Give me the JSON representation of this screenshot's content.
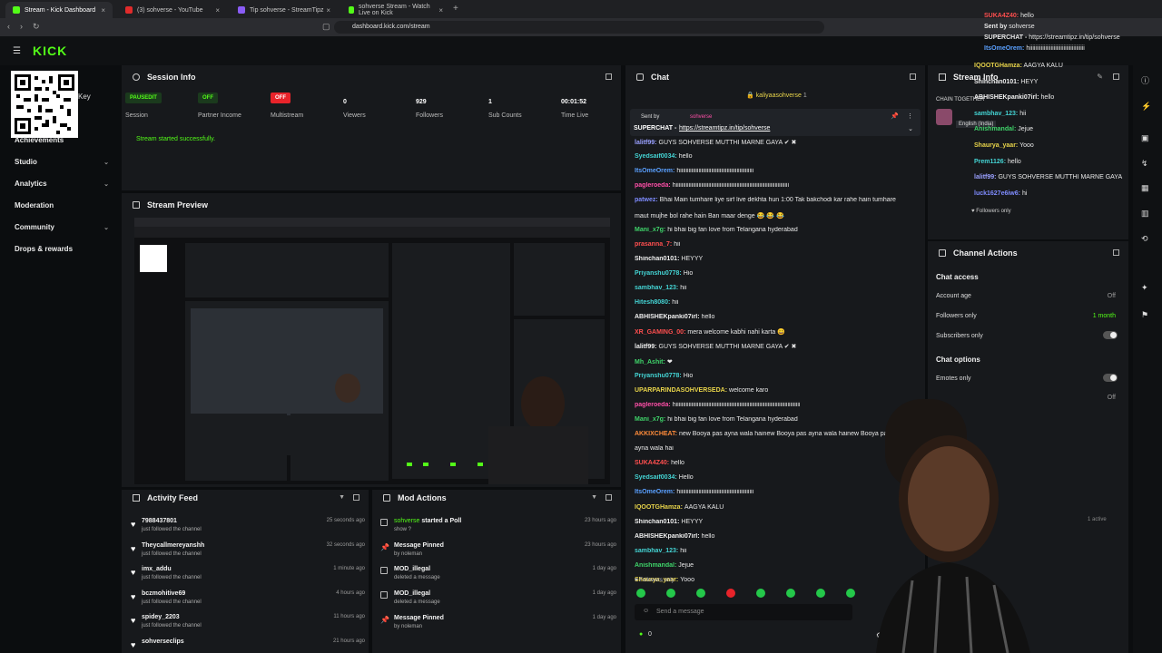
{
  "browser": {
    "tabs": [
      {
        "title": "Stream - Kick Dashboard",
        "active": true
      },
      {
        "title": "(3) sohverse - YouTube",
        "active": false
      },
      {
        "title": "Tip sohverse - StreamTipz",
        "active": false
      },
      {
        "title": "sohverse Stream - Watch Live on Kick",
        "active": false
      }
    ],
    "url": "dashboard.kick.com/stream"
  },
  "sidebar": {
    "logo": "KICK",
    "key_label": "Key",
    "items": [
      {
        "label": "Achievements",
        "has_chevron": false
      },
      {
        "label": "Studio",
        "has_chevron": true
      },
      {
        "label": "Analytics",
        "has_chevron": true
      },
      {
        "label": "Moderation",
        "has_chevron": false
      },
      {
        "label": "Community",
        "has_chevron": true
      },
      {
        "label": "Drops & rewards",
        "has_chevron": false
      }
    ]
  },
  "session": {
    "title": "Session Info",
    "stats": [
      {
        "value": "PAUSEDIT",
        "label": "Session",
        "kind": "badge-dark"
      },
      {
        "value": "OFF",
        "label": "Partner Income",
        "kind": "badge-dark"
      },
      {
        "value": "OFF",
        "label": "Multistream",
        "kind": "badge-red"
      },
      {
        "value": "0",
        "label": "Viewers",
        "kind": "text"
      },
      {
        "value": "929",
        "label": "Followers",
        "kind": "text"
      },
      {
        "value": "1",
        "label": "Sub Counts",
        "kind": "text"
      },
      {
        "value": "00:01:52",
        "label": "Time Live",
        "kind": "text"
      }
    ],
    "status": "Stream started successfully."
  },
  "preview": {
    "title": "Stream Preview"
  },
  "activity": {
    "title": "Activity Feed",
    "items": [
      {
        "name": "7988437801",
        "desc": "just followed the channel",
        "time": "25 seconds ago"
      },
      {
        "name": "Theycallmereyanshh",
        "desc": "just followed the channel",
        "time": "32 seconds ago"
      },
      {
        "name": "imx_addu",
        "desc": "just followed the channel",
        "time": "1 minute ago"
      },
      {
        "name": "bczmohitive69",
        "desc": "just followed the channel",
        "time": "4 hours ago"
      },
      {
        "name": "spidey_2203",
        "desc": "just followed the channel",
        "time": "11 hours ago"
      },
      {
        "name": "sohverseclips",
        "desc": "",
        "time": "21 hours ago"
      }
    ]
  },
  "modactions": {
    "title": "Mod Actions",
    "items": [
      {
        "name": "started a Poll",
        "who": "sohverse",
        "desc": "show ?",
        "time": "23 hours ago"
      },
      {
        "name": "Message Pinned",
        "who": "",
        "desc": "by noleman",
        "time": "23 hours ago"
      },
      {
        "name": "MOD_illegal",
        "who": "",
        "desc": "deleted a message",
        "time": "1 day ago"
      },
      {
        "name": "MOD_illegal",
        "who": "",
        "desc": "deleted a message",
        "time": "1 day ago"
      },
      {
        "name": "Message Pinned",
        "who": "",
        "desc": "by noleman",
        "time": "1 day ago"
      }
    ]
  },
  "chat": {
    "title": "Chat",
    "pinned_user": "kaliyaasohverse",
    "pinned_count": "1",
    "sent_by": "Sent by",
    "sent_by_user": "sohverse",
    "superchat_label": "SUPERCHAT -",
    "superchat_link": "https://streamtipz.in/tip/sohverse",
    "messages": [
      {
        "user": "lalitf99:",
        "color": "#9aa0ff",
        "text": "GUYS SOHVERSE MUTTHI MARNE GAYA ✔ ✖"
      },
      {
        "user": "Syedsaif0034:",
        "color": "#44d4d4",
        "text": "hello"
      },
      {
        "user": "ItsOmeOrem:",
        "color": "#5aa0ff",
        "text": "hiiiiiiiiiiiiiiiiiiiiiiiiiiiiiiiiiiiiiiiiiiiiiiiiiiii"
      },
      {
        "user": "pagleroeda:",
        "color": "#ff4fa8",
        "text": "hiiiiiiiiiiiiiiiiiiiiiiiiiiiiiiiiiiiiiiiiiiiiiiiiiiiiiiiiiiiiiiiiiiiiiiiiiiiiiiii"
      },
      {
        "user": "patwez:",
        "color": "#7f8cff",
        "text": "Bhai Main tumhare liye sirf live dekhta hun 1:00 Tak bakchodi kar rahe hain tumhare"
      },
      {
        "user": "",
        "color": "#e8e8e8",
        "text": "maut mujhe bol rahe hain Ban maar denge 😂 😂 😂"
      },
      {
        "user": "Mani_x7g:",
        "color": "#3fd46a",
        "text": "hi bhai big fan love from Telangana hyderabad"
      },
      {
        "user": "prasanna_7:",
        "color": "#ff4f4f",
        "text": "hii"
      },
      {
        "user": "Shinchan0101:",
        "color": "#f0f0f0",
        "text": "HEYYY"
      },
      {
        "user": "Priyanshu0778:",
        "color": "#44d4d4",
        "text": "Hio"
      },
      {
        "user": "sambhav_123:",
        "color": "#44d4d4",
        "text": "hii"
      },
      {
        "user": "Hitesh8080:",
        "color": "#44d4d4",
        "text": "hii"
      },
      {
        "user": "ABHISHEKpanki07irl:",
        "color": "#f0f0f0",
        "text": "hello"
      },
      {
        "user": "XR_GAMING_00:",
        "color": "#ff4f4f",
        "text": "mera welcome kabhi nahi karta 😄"
      },
      {
        "user": "lalitf99:",
        "color": "#f0f0f0",
        "text": "GUYS SOHVERSE MUTTHI MARNE GAYA ✔ ✖"
      },
      {
        "user": "Mh_Ashit:",
        "color": "#3fd46a",
        "text": "❤"
      },
      {
        "user": "Priyanshu0778:",
        "color": "#44d4d4",
        "text": "Hio"
      },
      {
        "user": "UPARPARINDASOHVERSEDA:",
        "color": "#e8d44a",
        "text": "welcome karo"
      },
      {
        "user": "pagleroeda:",
        "color": "#ff4fa8",
        "text": "hiiiiiiiiiiiiiiiiiiiiiiiiiiiiiiiiiiiiiiiiiiiiiiiiiiiiiiiiiiiiiiiiiiiiiiiiiiiiiiiiiiiiiiii"
      },
      {
        "user": "Mani_x7g:",
        "color": "#3fd46a",
        "text": "hi bhai big fan love from Telangana hyderabad"
      },
      {
        "user": "AKKIXCHEAT:",
        "color": "#ff8c3a",
        "text": "new Booya pas ayna wala hainew Booya pas ayna wala hainew Booya pas"
      },
      {
        "user": "",
        "color": "#e8e8e8",
        "text": "ayna wala hai"
      },
      {
        "user": "SUKA4Z40:",
        "color": "#ff4f4f",
        "text": "hello"
      },
      {
        "user": "Syedsaif0034:",
        "color": "#44d4d4",
        "text": "Hello"
      },
      {
        "user": "ItsOmeOrem:",
        "color": "#5aa0ff",
        "text": "hiiiiiiiiiiiiiiiiiiiiiiiiiiiiiiiiiiiiiiiiiiiiiiiiiiii"
      },
      {
        "user": "IQOOTGHamza:",
        "color": "#e8d44a",
        "text": "AAGYA KALU"
      },
      {
        "user": "Shinchan0101:",
        "color": "#f0f0f0",
        "text": "HEYYY"
      },
      {
        "user": "ABHISHEKpanki07irl:",
        "color": "#f0f0f0",
        "text": "hello"
      },
      {
        "user": "sambhav_123:",
        "color": "#44d4d4",
        "text": "hii"
      },
      {
        "user": "Anishmandal:",
        "color": "#3fd46a",
        "text": "Jejue"
      },
      {
        "user": "Shaurya_yaar:",
        "color": "#e8d44a",
        "text": "Yooo"
      }
    ],
    "followers_only": "Followers only",
    "send_placeholder": "Send a message",
    "count": "0"
  },
  "stream_info": {
    "title": "Stream Info",
    "chain_title": "CHAIN TOGETHER",
    "language": "English (India)",
    "overlay_lines": [
      {
        "user": "SUKA4Z40:",
        "color": "#ff4f4f",
        "text": "hello"
      },
      {
        "user": "Sent by",
        "color": "#e8e8e8",
        "text": "sohverse"
      },
      {
        "user": "SUPERCHAT -",
        "color": "#e8e8e8",
        "text": "https://streamtipz.in/tip/sohverse"
      },
      {
        "user": "ItsOmeOrem:",
        "color": "#5aa0ff",
        "text": "hiiiiiiiiiiiiiiiiiiiiiiiiiiiiiiiiiiiiiii"
      }
    ],
    "messages": [
      {
        "user": "IQOOTGHamza:",
        "color": "#e8d44a",
        "text": "AAGYA KALU"
      },
      {
        "user": "Shinchan0101:",
        "color": "#f0f0f0",
        "text": "HEYY"
      },
      {
        "user": "ABHISHEKpanki07irl:",
        "color": "#f0f0f0",
        "text": "hello"
      },
      {
        "user": "sambhav_123:",
        "color": "#44d4d4",
        "text": "hii"
      },
      {
        "user": "Anishmandal:",
        "color": "#3fd46a",
        "text": "Jejue"
      },
      {
        "user": "Shaurya_yaar:",
        "color": "#e8d44a",
        "text": "Yooo"
      },
      {
        "user": "Prem1126:",
        "color": "#44d4d4",
        "text": "hello"
      },
      {
        "user": "lalitf99:",
        "color": "#9aa0ff",
        "text": "GUYS SOHVERSE MUTTHI MARNE GAYA"
      },
      {
        "user": "luck1627e6iw6:",
        "color": "#7f8cff",
        "text": "hi"
      }
    ],
    "followers_only": "Followers only"
  },
  "channel_actions": {
    "title": "Channel Actions",
    "chat_access": "Chat access",
    "rows": [
      {
        "label": "Account age",
        "value": "Off",
        "type": "value"
      },
      {
        "label": "Followers only",
        "value": "1 month",
        "type": "value"
      },
      {
        "label": "Subscribers only",
        "value": "",
        "type": "toggle"
      }
    ],
    "chat_options": "Chat options",
    "option_rows": [
      {
        "label": "Emotes only",
        "value": "",
        "type": "toggle"
      },
      {
        "label": "",
        "value": "Off",
        "type": "value"
      }
    ],
    "active_count": "1 active"
  },
  "colors": {
    "accent": "#53fc18",
    "panel": "#17191c",
    "bg": "#0b0d0f",
    "offline_red": "#e8232a"
  }
}
